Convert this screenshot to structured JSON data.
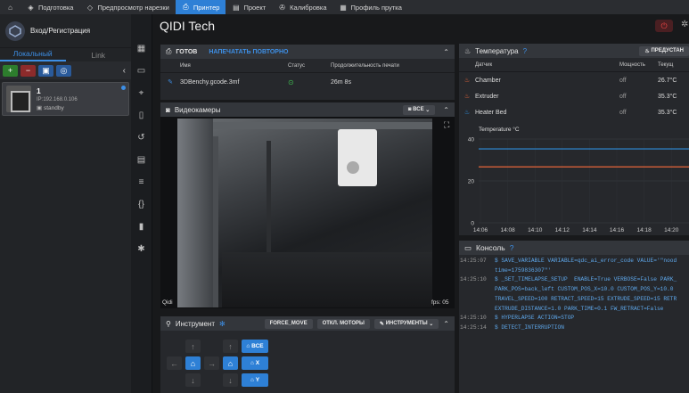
{
  "topnav": {
    "home_icon": "home-icon",
    "items": [
      {
        "label": "Подготовка",
        "icon": "layers-icon",
        "active": false
      },
      {
        "label": "Предпросмотр нарезки",
        "icon": "cube-icon",
        "active": false
      },
      {
        "label": "Принтер",
        "icon": "printer-icon",
        "active": true
      },
      {
        "label": "Проект",
        "icon": "project-icon",
        "active": false
      },
      {
        "label": "Калибровка",
        "icon": "calibration-icon",
        "active": false
      },
      {
        "label": "Профиль прутка",
        "icon": "filament-icon",
        "active": false
      }
    ]
  },
  "sidebar": {
    "login_label": "Вход/Регистрация",
    "tab_local": "Локальный",
    "tab_link": "Link",
    "printer": {
      "name": "1",
      "ip": "IP:192.168.0.106",
      "status": "standby"
    }
  },
  "header": {
    "title": "QIDI Tech",
    "preheat_label": "ПРЕДУСТАН"
  },
  "job": {
    "status": "ГОТОВ",
    "reprint_label": "НАПЕЧАТАТЬ ПОВТОРНО",
    "columns": [
      "Имя",
      "Статус",
      "Продолжительность печати"
    ],
    "rows": [
      {
        "name": "3DBenchy.gcode.3mf",
        "status": "ok",
        "duration": "26m 8s"
      }
    ]
  },
  "cameras": {
    "title": "Видеокамеры",
    "filter_label": "ВСЕ",
    "camera_name": "Qidi",
    "fps": "fps: 05"
  },
  "tools": {
    "title": "Инструмент",
    "force_move": "FORCE_MOVE",
    "motors_off": "ОТКЛ. МОТОРЫ",
    "tools_label": "ИНСТРУМЕНТЫ",
    "home_all": "ВСЕ",
    "home_x": "X",
    "home_y": "Y"
  },
  "temperature": {
    "title": "Температура",
    "columns": [
      "Датчик",
      "Мощность",
      "Текущ"
    ],
    "sensors": [
      {
        "name": "Chamber",
        "power": "off",
        "current": "26.7°C",
        "color": "#e8663a"
      },
      {
        "name": "Extruder",
        "power": "off",
        "current": "35.3°C",
        "color": "#e8663a"
      },
      {
        "name": "Heater Bed",
        "power": "off",
        "current": "35.3°C",
        "color": "#2e8fe0"
      }
    ]
  },
  "chart_data": {
    "type": "line",
    "ylabel": "Temperature °C",
    "ylim": [
      0,
      40
    ],
    "yticks": [
      0,
      20,
      40
    ],
    "categories": [
      "14:06",
      "14:08",
      "14:10",
      "14:12",
      "14:14",
      "14:16",
      "14:18",
      "14:20"
    ],
    "series": [
      {
        "name": "Chamber",
        "color": "#e8663a",
        "values": [
          26.7,
          26.7,
          26.7,
          26.7,
          26.7,
          26.7,
          26.7,
          26.7
        ]
      },
      {
        "name": "Heater Bed",
        "color": "#2e8fe0",
        "values": [
          35.3,
          35.3,
          35.3,
          35.3,
          35.3,
          35.3,
          35.3,
          35.3
        ]
      }
    ]
  },
  "console": {
    "title": "Консоль",
    "lines": [
      {
        "time": "14:25:07",
        "msg": "$ SAVE_VARIABLE VARIABLE=qdc_ai_error_code VALUE='\"nood"
      },
      {
        "time": "",
        "msg": "time=1759836307\"'"
      },
      {
        "time": "14:25:10",
        "msg": "$ _SET_TIMELAPSE_SETUP  ENABLE=True VERBOSE=False PARK_"
      },
      {
        "time": "",
        "msg": "PARK_POS=back_left CUSTOM_POS_X=10.0 CUSTOM_POS_Y=10.0"
      },
      {
        "time": "",
        "msg": "TRAVEL_SPEED=100 RETRACT_SPEED=15 EXTRUDE_SPEED=15 RETR"
      },
      {
        "time": "",
        "msg": "EXTRUDE_DISTANCE=1.0 PARK_TIME=0.1 FW_RETRACT=False"
      },
      {
        "time": "14:25:10",
        "msg": "$ HYPERLAPSE ACTION=STOP"
      },
      {
        "time": "14:25:14",
        "msg": "$ DETECT_INTERRUPTION"
      }
    ]
  }
}
